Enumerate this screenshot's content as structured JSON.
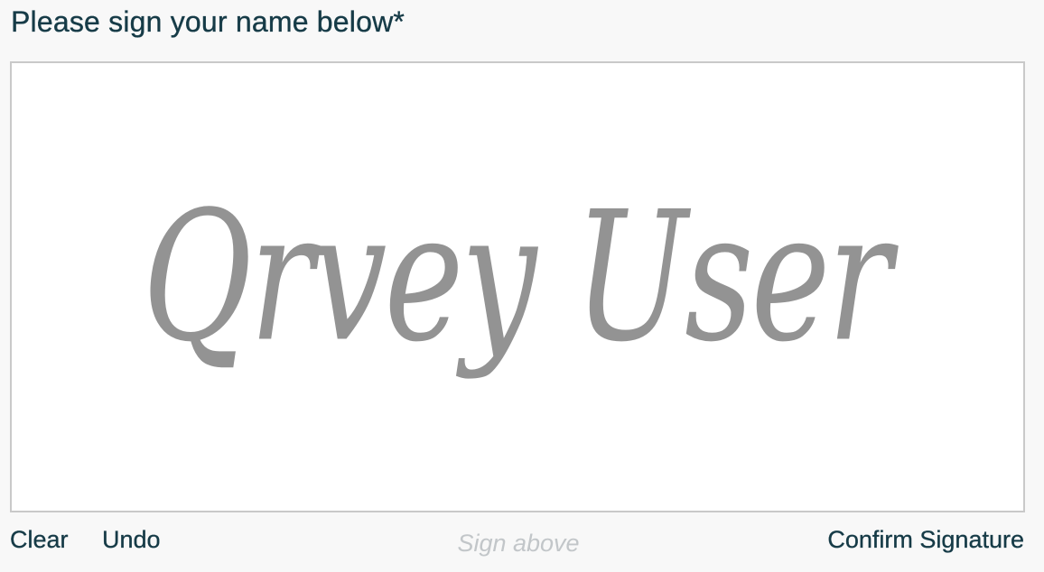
{
  "question": {
    "title": "Please sign your name below*"
  },
  "signature": {
    "text": "Qrvey User",
    "ink_color": "#939393",
    "border_color": "#c9c9c9"
  },
  "actions": {
    "clear_label": "Clear",
    "undo_label": "Undo",
    "hint": "Sign above",
    "confirm_label": "Confirm Signature"
  },
  "colors": {
    "text_primary": "#163b47",
    "hint_text": "#c2c6c9",
    "background": "#f8f8f8",
    "pad_background": "#ffffff"
  }
}
